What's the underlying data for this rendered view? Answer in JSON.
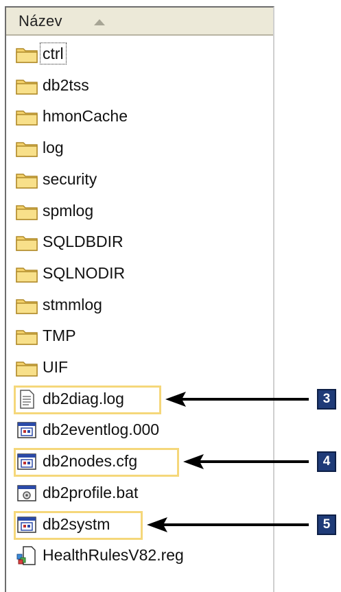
{
  "header": {
    "name_column": "Název",
    "sort_direction": "ascending"
  },
  "files": [
    {
      "name": "ctrl",
      "icon": "folder-icon",
      "focused": true
    },
    {
      "name": "db2tss",
      "icon": "folder-icon"
    },
    {
      "name": "hmonCache",
      "icon": "folder-icon"
    },
    {
      "name": "log",
      "icon": "folder-icon"
    },
    {
      "name": "security",
      "icon": "folder-icon"
    },
    {
      "name": "spmlog",
      "icon": "folder-icon"
    },
    {
      "name": "SQLDBDIR",
      "icon": "folder-icon"
    },
    {
      "name": "SQLNODIR",
      "icon": "folder-icon"
    },
    {
      "name": "stmmlog",
      "icon": "folder-icon"
    },
    {
      "name": "TMP",
      "icon": "folder-icon"
    },
    {
      "name": "UIF",
      "icon": "folder-icon"
    },
    {
      "name": "db2diag.log",
      "icon": "text-file-icon",
      "highlighted": true
    },
    {
      "name": "db2eventlog.000",
      "icon": "system-file-icon"
    },
    {
      "name": "db2nodes.cfg",
      "icon": "system-file-icon",
      "highlighted": true
    },
    {
      "name": "db2profile.bat",
      "icon": "batch-file-icon"
    },
    {
      "name": "db2systm",
      "icon": "system-file-icon",
      "highlighted": true
    },
    {
      "name": "HealthRulesV82.reg",
      "icon": "registry-file-icon"
    }
  ],
  "callouts": [
    {
      "number": "3",
      "target": "db2diag.log"
    },
    {
      "number": "4",
      "target": "db2nodes.cfg"
    },
    {
      "number": "5",
      "target": "db2systm"
    }
  ],
  "colors": {
    "highlight_border": "#f5d77a",
    "badge_background": "#1f3b78",
    "header_background": "#ece9d8",
    "folder_yellow": "#f3d16b"
  }
}
